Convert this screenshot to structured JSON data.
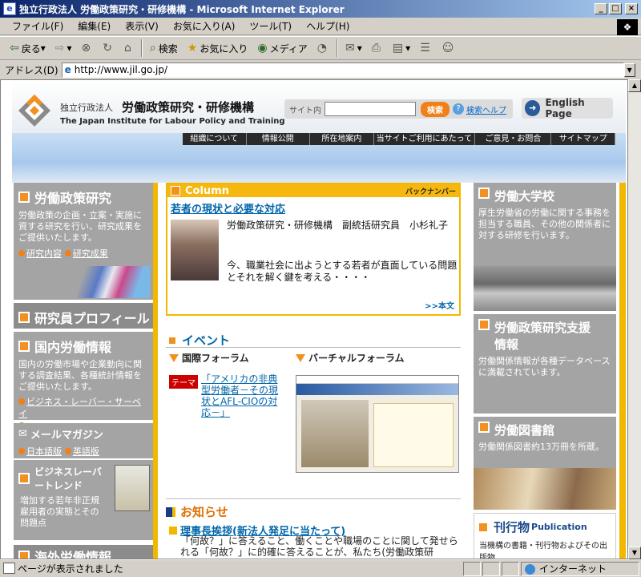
{
  "window": {
    "title": "独立行政法人 労働政策研究・研修機構 - Microsoft Internet Explorer",
    "minimize": "_",
    "maximize": "□",
    "close": "×"
  },
  "menu": [
    "ファイル(F)",
    "編集(E)",
    "表示(V)",
    "お気に入り(A)",
    "ツール(T)",
    "ヘルプ(H)"
  ],
  "toolbar": {
    "back": "戻る",
    "search": "検索",
    "favorites": "お気に入り",
    "media": "メディア"
  },
  "address": {
    "label": "アドレス(D)",
    "url": "http://www.jil.go.jp/"
  },
  "status": {
    "text": "ページが表示されました",
    "zone": "インターネット"
  },
  "header": {
    "org_prefix": "独立行政法人",
    "org_name": "労働政策研究・研修機構",
    "org_english": "The Japan Institute for Labour Policy and Training",
    "search_label": "サイト内",
    "search_button": "検索",
    "search_help": "検索ヘルプ",
    "english_page": "English Page"
  },
  "nav": [
    "組織について",
    "情報公開",
    "所在地案内",
    "当サイトご利用にあたって",
    "ご意見・お問合",
    "サイトマップ"
  ],
  "left": {
    "research_title": "労働政策研究",
    "research_text": "労働政策の企画・立案・実施に資する研究を行い、研究成果をご提供いたします。",
    "research_link1": "研究内容",
    "research_link2": "研究成果",
    "profile_title": "研究員プロフィール",
    "domestic_title": "国内労働情報",
    "domestic_text": "国内の労働市場や企業動向に関する調査結果、各種統計情報をご提供いたします。",
    "domestic_link1": "ビジネス・レーバー・サーベイ",
    "domestic_link2": "統計情報",
    "mail_title": "メールマガジン",
    "mail_link1": "日本語版",
    "mail_link2": "英語版",
    "blt_title": "ビジネスレーバートレンド",
    "blt_text": "増加する若年非正規雇用者の実態とその問題点",
    "overseas_title": "海外労働情報"
  },
  "column": {
    "head": "Column",
    "back_numbers": "バックナンバー",
    "title": "若者の現状と必要な対応",
    "author": "労働政策研究・研修機構　副統括研究員　小杉礼子",
    "text": "今、職業社会に出ようとする若者が直面している問題とそれを解く鍵を考える・・・・",
    "more": ">>本文"
  },
  "event": {
    "head": "イベント",
    "intl_forum": "国際フォーラム",
    "virtual_forum": "バーチャルフォーラム",
    "theme_tag": "テーマ",
    "theme_link": "「アメリカの非典型労働者－その現状とAFL-CIOの対応－」"
  },
  "news": {
    "head": "お知らせ",
    "item_title": "理事長挨拶(新法人発足に当たって)",
    "item_text": "「何故？」に答えること、働くことや職場のことに関して発せられる「何故？」に的確に答えることが、私たち(労働政策研"
  },
  "right": {
    "univ_title": "労働大学校",
    "univ_text": "厚生労働省の労働に関する事務を担当する職員、その他の関係者に対する研修を行います。",
    "support_title": "労働政策研究支援情報",
    "support_text": "労働関係情報が各種データベースに満載されています。",
    "library_title": "労働図書館",
    "library_text": "労働関係図書約13万冊を所蔵。",
    "pub_title": "刊行物",
    "pub_title_en": "Publication",
    "pub_text": "当機構の書籍・刊行物およびその出版物"
  },
  "colors": {
    "accent_orange": "#f29020",
    "accent_yellow": "#f2b800",
    "link_blue": "#0066aa",
    "panel_gray": "#a4a4a4"
  }
}
